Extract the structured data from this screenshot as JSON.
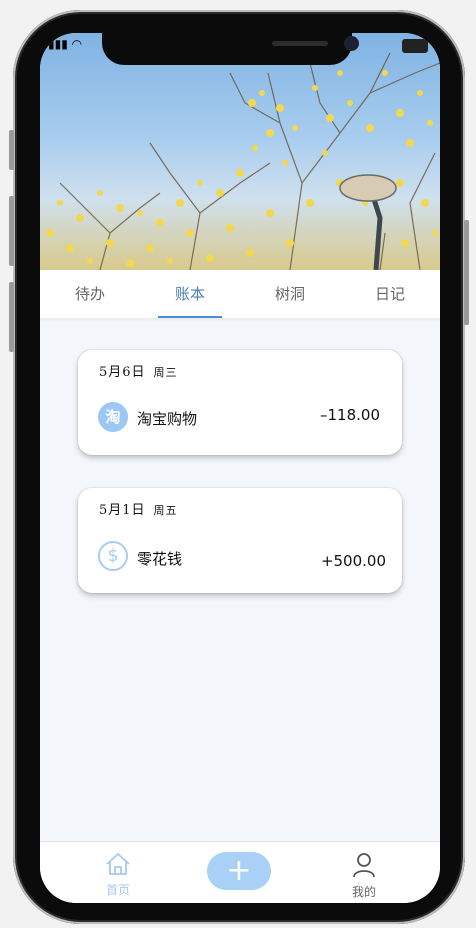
{
  "tabs": [
    "待办",
    "账本",
    "树洞",
    "日记"
  ],
  "active_tab_index": 1,
  "cards": [
    {
      "date": "5月6日",
      "weekday": "周三",
      "icon": "taobao-icon",
      "icon_text": "淘",
      "name": "淘宝购物",
      "amount": "–118.00"
    },
    {
      "date": "5月1日",
      "weekday": "周五",
      "icon": "dollar-icon",
      "icon_text": "$",
      "name": "零花钱",
      "amount": "+500.00"
    }
  ],
  "bottom_nav": {
    "home_label": "首页",
    "add_label": "+",
    "me_label": "我的"
  },
  "colors": {
    "accent": "#4a90d9",
    "icon_blue": "#9cc8f5",
    "fab": "#a9d0f7"
  }
}
